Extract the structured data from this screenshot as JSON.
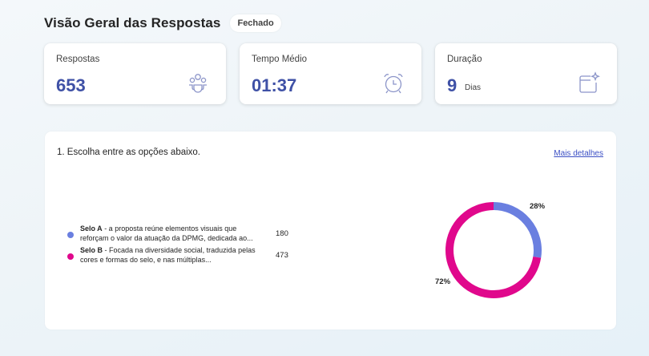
{
  "header": {
    "title": "Visão Geral das Respostas",
    "status": "Fechado"
  },
  "stats": [
    {
      "label": "Respostas",
      "value": "653",
      "unit": "",
      "icon": "people-icon"
    },
    {
      "label": "Tempo Médio",
      "value": "01:37",
      "unit": "",
      "icon": "alarm-clock-icon"
    },
    {
      "label": "Duração",
      "value": "9",
      "unit": "Dias",
      "icon": "calendar-sparkle-icon"
    }
  ],
  "question": {
    "title": "1. Escolha entre as opções abaixo.",
    "details_link": "Mais detalhes",
    "options": [
      {
        "name": "Selo A",
        "desc": " - a proposta reúne elementos visuais que reforçam o valor da atuação da DPMG, dedicada ao...",
        "count": "180",
        "pct": "28%",
        "color": "#6a7fe0"
      },
      {
        "name": "Selo B",
        "desc": " - Focada na diversidade social, traduzida pelas cores e formas do selo, e nas múltiplas...",
        "count": "473",
        "pct": "72%",
        "color": "#e0088c"
      }
    ]
  },
  "chart_data": {
    "type": "pie",
    "categories": [
      "Selo A",
      "Selo B"
    ],
    "values": [
      180,
      473
    ],
    "labels": [
      "28%",
      "72%"
    ],
    "colors": [
      "#6a7fe0",
      "#e0088c"
    ],
    "title": ""
  }
}
